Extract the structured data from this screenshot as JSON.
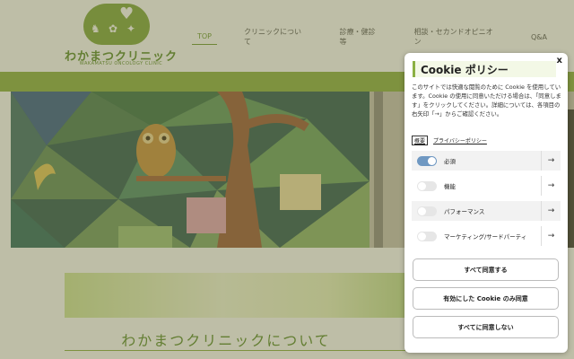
{
  "site": {
    "logo_name": "わかまつクリニック",
    "logo_sub": "WAKAMATSU ONCOLOGY CLINIC",
    "nav": [
      {
        "label": "TOP",
        "active": true
      },
      {
        "label": "クリニックについて"
      },
      {
        "label": "診療・健診等"
      },
      {
        "label": "相談・セカンドオピニオン"
      },
      {
        "label": "Q&A"
      }
    ],
    "about_title": "わかまつクリニックについて"
  },
  "cookie_panel": {
    "title": "Cookie ポリシー",
    "close_label": "x",
    "description": "このサイトでは快適な閲覧のために Cookie を使用しています。Cookie の使用に同意いただける場合は、「同意します」をクリックしてください。詳細については、各項目の右矢印「→」からご確認ください。",
    "details_link": "概要",
    "privacy_link": "プライバシーポリシー",
    "categories": [
      {
        "label": "必須",
        "enabled": true
      },
      {
        "label": "機能",
        "enabled": false
      },
      {
        "label": "パフォーマンス",
        "enabled": false
      },
      {
        "label": "マーケティング/サードパーティ",
        "enabled": false
      }
    ],
    "arrow_icon": "→",
    "buttons": {
      "accept_all": "すべて同意する",
      "accept_enabled": "有効にした Cookie のみ同意",
      "reject_all": "すべてに同意しない"
    }
  },
  "colors": {
    "brand_green": "#8bb043",
    "toggle_on": "#6f98c2"
  }
}
